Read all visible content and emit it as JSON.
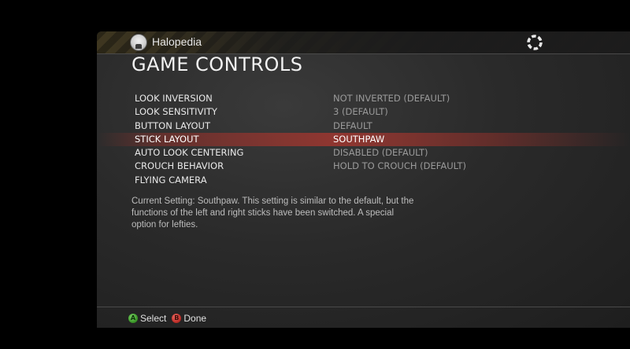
{
  "header": {
    "app_name": "Halopedia",
    "logo_icon": "halopedia-logo-icon",
    "spinner_icon": "loading-ring-icon"
  },
  "page": {
    "title": "GAME CONTROLS"
  },
  "menu": {
    "items": [
      {
        "label": "LOOK INVERSION",
        "value": "NOT INVERTED (DEFAULT)"
      },
      {
        "label": "LOOK SENSITIVITY",
        "value": "3 (DEFAULT)"
      },
      {
        "label": "BUTTON LAYOUT",
        "value": "DEFAULT"
      },
      {
        "label": "STICK LAYOUT",
        "value": "SOUTHPAW"
      },
      {
        "label": "AUTO LOOK CENTERING",
        "value": "DISABLED (DEFAULT)"
      },
      {
        "label": "CROUCH BEHAVIOR",
        "value": "HOLD TO CROUCH (DEFAULT)"
      },
      {
        "label": "FLYING CAMERA",
        "value": ""
      }
    ],
    "selected_index": 3
  },
  "description": "Current Setting: Southpaw. This setting is similar to the default, but the functions of the left and right sticks have been switched. A special option for lefties.",
  "footer": {
    "select_button": "A",
    "select_label": "Select",
    "done_button": "B",
    "done_label": "Done"
  },
  "colors": {
    "highlight": "#a0372f",
    "button_a": "#3d9a2a",
    "button_b": "#c0302a"
  }
}
